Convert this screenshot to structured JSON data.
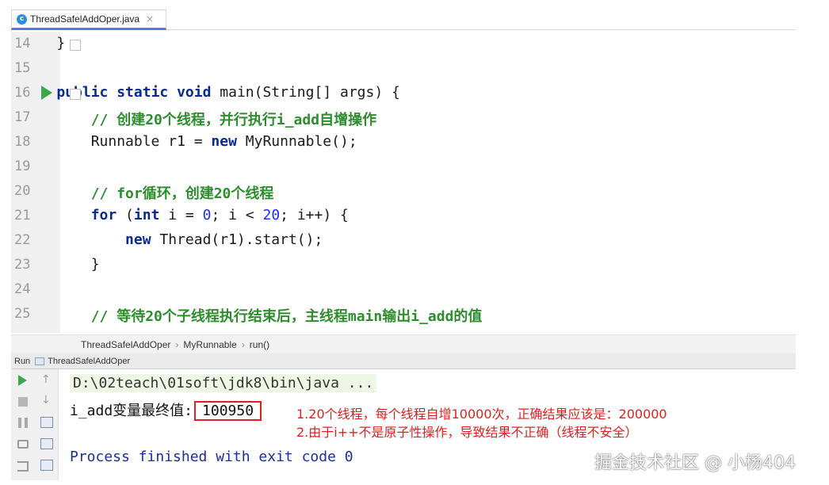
{
  "tab": {
    "title": "ThreadSafelAddOper.java",
    "close": "×",
    "icon": "c-class-icon"
  },
  "editor": {
    "lines": [
      {
        "num": "14",
        "segments": [
          {
            "t": "    }",
            "c": ""
          }
        ]
      },
      {
        "num": "15",
        "segments": []
      },
      {
        "num": "16",
        "segments": [
          {
            "t": "    ",
            "c": ""
          },
          {
            "t": "public static void",
            "c": "kw"
          },
          {
            "t": " main(String[] args) {",
            "c": ""
          }
        ]
      },
      {
        "num": "17",
        "segments": [
          {
            "t": "        // 创建20个线程，并行执行i_add自增操作",
            "c": "cm"
          }
        ]
      },
      {
        "num": "18",
        "segments": [
          {
            "t": "        Runnable r1 = ",
            "c": ""
          },
          {
            "t": "new",
            "c": "kw"
          },
          {
            "t": " MyRunnable();",
            "c": ""
          }
        ]
      },
      {
        "num": "19",
        "segments": []
      },
      {
        "num": "20",
        "segments": [
          {
            "t": "        // for循环，创建20个线程",
            "c": "cm"
          }
        ]
      },
      {
        "num": "21",
        "segments": [
          {
            "t": "        ",
            "c": ""
          },
          {
            "t": "for",
            "c": "kw"
          },
          {
            "t": " (",
            "c": ""
          },
          {
            "t": "int",
            "c": "kw"
          },
          {
            "t": " i = ",
            "c": ""
          },
          {
            "t": "0",
            "c": "num"
          },
          {
            "t": "; i < ",
            "c": ""
          },
          {
            "t": "20",
            "c": "num"
          },
          {
            "t": "; i++) {",
            "c": ""
          }
        ]
      },
      {
        "num": "22",
        "segments": [
          {
            "t": "            ",
            "c": ""
          },
          {
            "t": "new",
            "c": "kw"
          },
          {
            "t": " Thread(r1).start();",
            "c": ""
          }
        ]
      },
      {
        "num": "23",
        "segments": [
          {
            "t": "        }",
            "c": ""
          }
        ]
      },
      {
        "num": "24",
        "segments": []
      },
      {
        "num": "25",
        "segments": [
          {
            "t": "        // 等待20个子线程执行结束后，主线程main输出i_add的值",
            "c": "cm"
          }
        ]
      }
    ]
  },
  "breadcrumb": {
    "items": [
      "ThreadSafelAddOper",
      "MyRunnable",
      "run()"
    ],
    "sep": "›"
  },
  "runbar": {
    "title": "Run",
    "tab": "ThreadSafelAddOper"
  },
  "console": {
    "command": "D:\\02teach\\01soft\\jdk8\\bin\\java ...",
    "output_label": "i_add变量最终值:",
    "output_value": "100950",
    "exit": "Process finished with exit code 0"
  },
  "notes": {
    "line1": "1.20个线程，每个线程自增10000次，正确结果应该是：200000",
    "line2": "2.由于i++不是原子性操作，导致结果不正确（线程不安全）"
  },
  "watermark": "掘金技术社区 @ 小杨404",
  "colors": {
    "keyword": "#0a2a8f",
    "comment": "#2d8d2d",
    "number": "#1a2eff",
    "annotation": "#e02020"
  }
}
